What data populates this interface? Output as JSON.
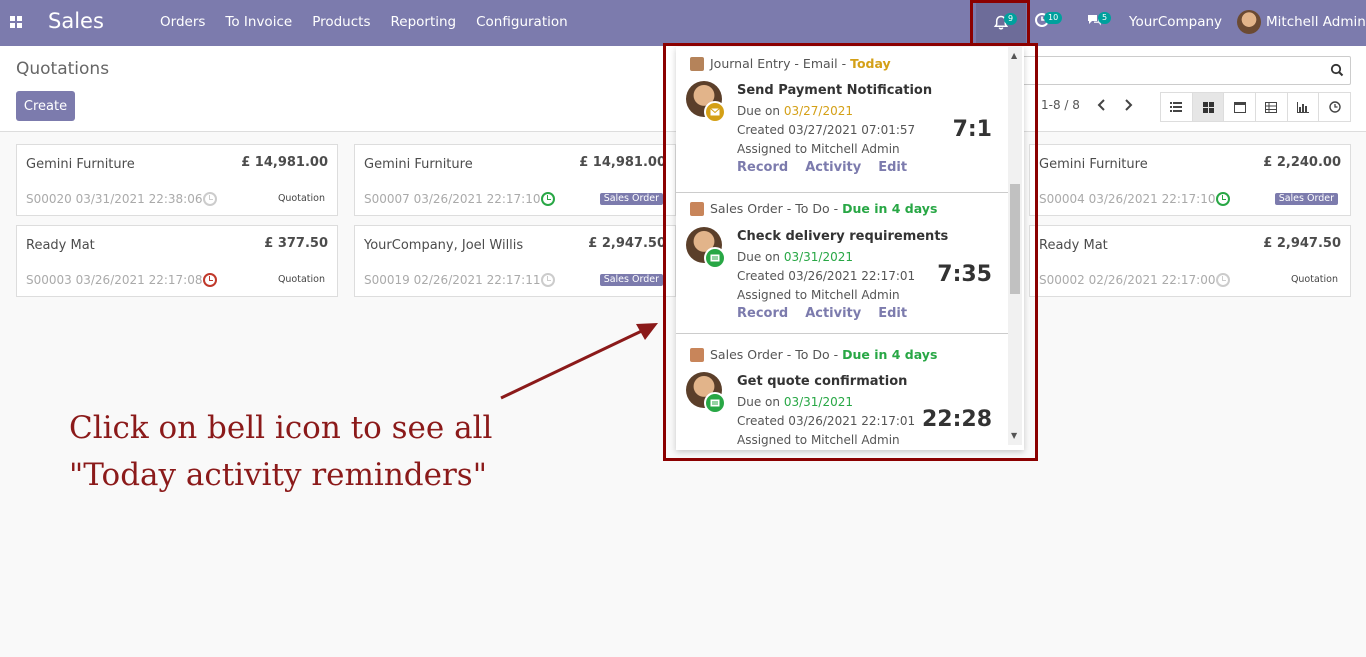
{
  "navbar": {
    "app_name": "Sales",
    "menu": [
      "Orders",
      "To Invoice",
      "Products",
      "Reporting",
      "Configuration"
    ],
    "bell_count": "9",
    "activity_count": "10",
    "message_count": "5",
    "company": "YourCompany",
    "user": "Mitchell Admin"
  },
  "control": {
    "title": "Quotations",
    "create_label": "Create",
    "pager": "1-8 / 8"
  },
  "cards": [
    {
      "customer": "Gemini Furniture",
      "amount": "£ 14,981.00",
      "ref": "S00020 03/31/2021 22:38:06",
      "status": "Quotation",
      "clock": "grey"
    },
    {
      "customer": "Gemini Furniture",
      "amount": "£ 14,981.00",
      "ref": "S00007 03/26/2021 22:17:10",
      "status": "Sales Order",
      "clock": "green"
    },
    {
      "customer": "Gemini Furniture",
      "amount": "£ 2,240.00",
      "ref": "S00004 03/26/2021 22:17:10",
      "status": "Sales Order",
      "clock": "green"
    },
    {
      "customer": "Ready Mat",
      "amount": "£ 377.50",
      "ref": "S00003 03/26/2021 22:17:08",
      "status": "Quotation",
      "clock": "red"
    },
    {
      "customer": "YourCompany, Joel Willis",
      "amount": "£ 2,947.50",
      "ref": "S00019 02/26/2021 22:17:11",
      "status": "Sales Order",
      "clock": "grey"
    },
    {
      "customer": "Ready Mat",
      "amount": "£ 2,947.50",
      "ref": "S00002 02/26/2021 22:17:00",
      "status": "Quotation",
      "clock": "grey"
    }
  ],
  "activities": [
    {
      "model": "Journal Entry - Email",
      "due_label": "Today",
      "summary": "Send Payment Notification",
      "due_prefix": "Due on ",
      "due_date": "03/27/2021",
      "created": "Created 03/27/2021 07:01:57",
      "assigned": "Assigned to Mitchell Admin",
      "timer": "7:1",
      "actions": [
        "Record",
        "Activity",
        "Edit"
      ]
    },
    {
      "model": "Sales Order - To Do",
      "due_label": "Due in 4 days",
      "summary": "Check delivery requirements",
      "due_prefix": "Due on ",
      "due_date": "03/31/2021",
      "created": "Created 03/26/2021 22:17:01",
      "assigned": "Assigned to Mitchell Admin",
      "timer": "7:35",
      "actions": [
        "Record",
        "Activity",
        "Edit"
      ]
    },
    {
      "model": "Sales Order - To Do",
      "due_label": "Due in 4 days",
      "summary": "Get quote confirmation",
      "due_prefix": "Due on ",
      "due_date": "03/31/2021",
      "created": "Created 03/26/2021 22:17:01",
      "assigned": "Assigned to Mitchell Admin",
      "timer": "22:28"
    }
  ],
  "annotation": {
    "line1": "Click on bell icon to see all",
    "line2": "\"Today activity reminders\""
  },
  "colors": {
    "brand": "#7c7bad",
    "highlight": "#8b0000",
    "due_today": "#d4a017",
    "due_future": "#28a745"
  }
}
